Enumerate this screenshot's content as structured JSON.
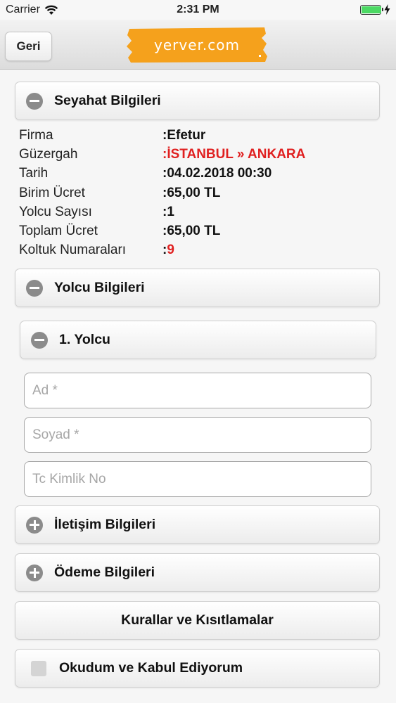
{
  "status_bar": {
    "carrier": "Carrier",
    "time": "2:31 PM",
    "battery_level": 1.0,
    "icons": [
      "wifi-icon",
      "battery-icon",
      "charging-bolt-icon"
    ]
  },
  "header": {
    "back_label": "Geri",
    "logo_text": "yerver.com",
    "logo_color": "#f5a11c"
  },
  "trip": {
    "section_title": "Seyahat Bilgileri",
    "rows": [
      {
        "label": "Firma",
        "value": ":Efetur"
      },
      {
        "label": "Güzergah",
        "value": ":İSTANBUL » ANKARA"
      },
      {
        "label": "Tarih",
        "value": ":04.02.2018 00:30"
      },
      {
        "label": "Birim Ücret",
        "value": ":65,00 TL"
      },
      {
        "label": "Yolcu Sayısı",
        "value": ":1"
      },
      {
        "label": "Toplam Ücret",
        "value": ":65,00 TL"
      },
      {
        "label": "Koltuk Numaraları",
        "value_prefix": ":",
        "value": "9"
      }
    ]
  },
  "passengers": {
    "section_title": "Yolcu Bilgileri",
    "passenger_title": "1. Yolcu",
    "fields": {
      "name_placeholder": "Ad *",
      "surname_placeholder": "Soyad *",
      "tc_placeholder": "Tc Kimlik No"
    }
  },
  "contact": {
    "section_title": "İletişim Bilgileri"
  },
  "payment": {
    "section_title": "Ödeme Bilgileri"
  },
  "rules": {
    "label": "Kurallar ve Kısıtlamalar"
  },
  "agree": {
    "label": "Okudum ve Kabul Ediyorum",
    "checked": false
  },
  "colors": {
    "accent_red": "#e02020",
    "collapse_icon": "#8b8b8b"
  }
}
